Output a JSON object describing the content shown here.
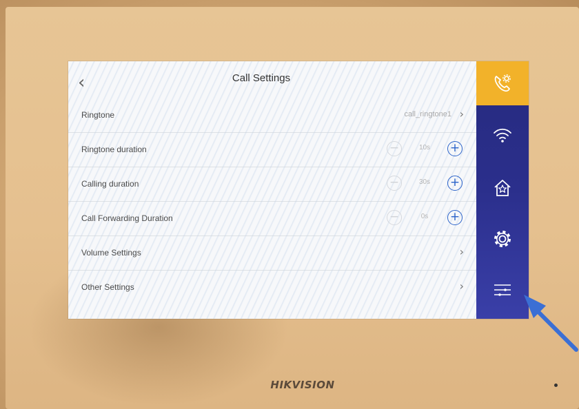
{
  "header": {
    "back_icon": "chevron-left-icon",
    "title": "Call Settings"
  },
  "rows": [
    {
      "label": "Ringtone",
      "value": "call_ringtone1",
      "control": "chevron"
    },
    {
      "label": "Ringtone duration",
      "value": "10s",
      "control": "stepper"
    },
    {
      "label": "Calling duration",
      "value": "30s",
      "control": "stepper"
    },
    {
      "label": "Call Forwarding Duration",
      "value": "0s",
      "control": "stepper"
    },
    {
      "label": "Volume Settings",
      "value": "",
      "control": "chevron"
    },
    {
      "label": "Other Settings",
      "value": "",
      "control": "chevron"
    }
  ],
  "sidebar": {
    "items": [
      {
        "icon": "phone-settings-icon",
        "active": true
      },
      {
        "icon": "wifi-icon",
        "active": false
      },
      {
        "icon": "home-icon",
        "active": false
      },
      {
        "icon": "gear-icon",
        "active": false
      },
      {
        "icon": "sliders-icon",
        "active": false
      }
    ]
  },
  "device": {
    "brand": "HIKVISION"
  },
  "colors": {
    "sidebar": "#2b2f8c",
    "active": "#f2b22a",
    "accent": "#2a62c9",
    "annotation_arrow": "#3b6fd4"
  }
}
